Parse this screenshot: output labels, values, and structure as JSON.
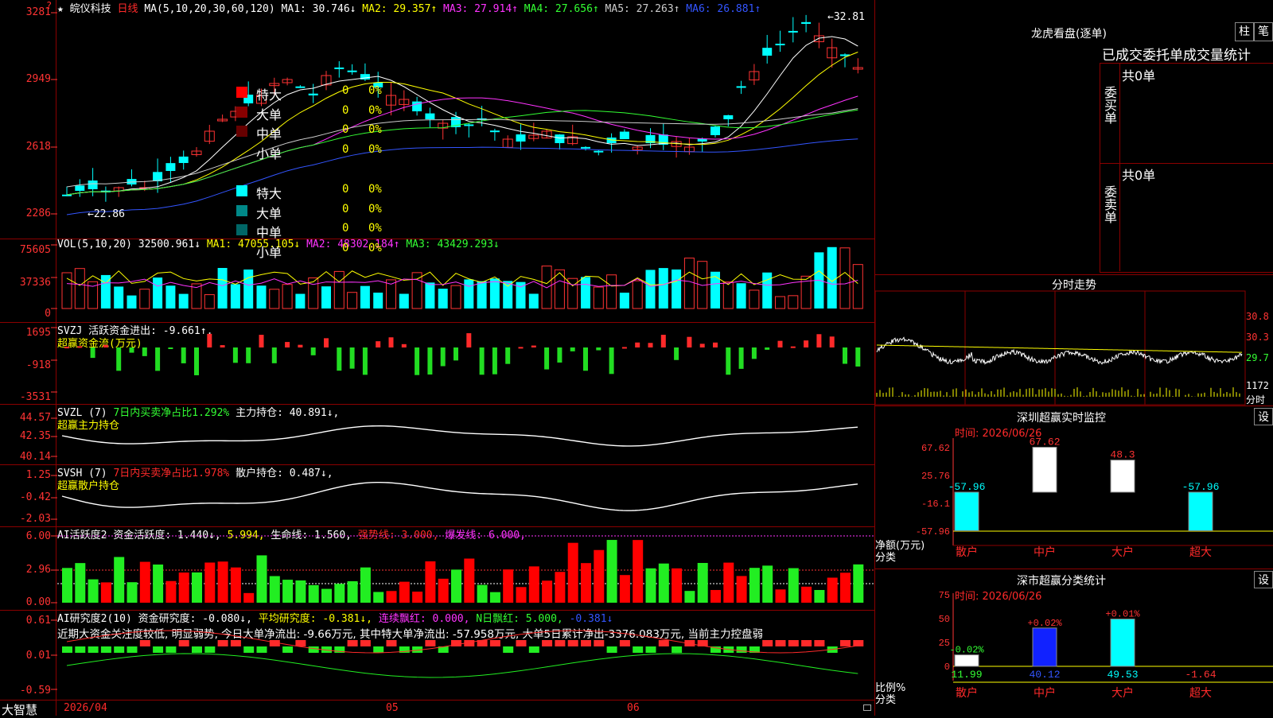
{
  "stock": {
    "name": "皖仪科技",
    "period": "日线",
    "star": "★",
    "q": "?"
  },
  "ma_line": {
    "label": "MA(5,10,20,30,60,120)",
    "items": [
      {
        "text": "MA1: 30.746↓",
        "color": "#ffffff"
      },
      {
        "text": "MA2: 29.357↑",
        "color": "#ffff00"
      },
      {
        "text": "MA3: 27.914↑",
        "color": "#ff33ff"
      },
      {
        "text": "MA4: 27.656↑",
        "color": "#33ff33"
      },
      {
        "text": "MA5: 27.263↑",
        "color": "#cccccc"
      },
      {
        "text": "MA6: 26.881↑",
        "color": "#3355ff"
      }
    ]
  },
  "price_axis": [
    "3281",
    "2949",
    "2618",
    "2286"
  ],
  "price_marks": {
    "high": "32.81",
    "low": "22.86"
  },
  "vol": {
    "label": "VOL(5,10,20)",
    "value": "32500.961↓",
    "ma1": "MA1: 47055.105↓",
    "ma2": "MA2: 48302.184↑",
    "ma3": "MA3: 43429.293↓",
    "axis": [
      "75605",
      "37336",
      "0"
    ]
  },
  "svzj": {
    "label": "SVZJ",
    "text": "活跃资金进出: -9.661↑,",
    "sub": "超赢资金流(万元)",
    "axis": [
      "1695",
      "-918",
      "-3531"
    ]
  },
  "svzl": {
    "label": "SVZL (7)",
    "text1": "7日内买卖净占比1.292%",
    "text2": "主力持仓: 40.891↓,",
    "sub": "超赢主力持仓",
    "axis": [
      "44.57",
      "42.35",
      "40.14"
    ]
  },
  "svsh": {
    "label": "SVSH (7)",
    "text1": "7日内买卖净占比1.978%",
    "text2": "散户持仓: 0.487↓,",
    "sub": "超赢散户持仓",
    "axis": [
      "1.25",
      "-0.42",
      "-2.03"
    ]
  },
  "ai1": {
    "label": "AI活跃度2",
    "t1": "资金活跃度: 1.440↓,",
    "t2": "5.994,",
    "t3": "生命线: 1.560,",
    "t4": "强势线: 3.000,",
    "t5": "爆发线: 6.000,",
    "axis": [
      "6.00",
      "2.96",
      "0.00"
    ]
  },
  "ai2": {
    "label": "AI研究度2(10)",
    "t1": "资金研究度: -0.080↓,",
    "t2": "平均研究度: -0.381↓,",
    "t3": "连续飘红: 0.000,",
    "t4": "N日飘红: 5.000,",
    "t5": "-0.381↓",
    "comment": "近期大资金关注度较低, 明显弱势, 今日大单净流出: -9.66万元, 其中特大单净流出: -57.958万元, 大单5日累计净出-3376.083万元, 当前主力控盘弱",
    "axis": [
      "0.61",
      "0.01",
      "-0.59"
    ]
  },
  "date_axis": {
    "brand": "大智慧",
    "d1": "2026/04",
    "d2": "05",
    "d3": "06"
  },
  "right": {
    "title": "龙虎看盘(逐单)",
    "btn1": "柱",
    "btn2": "笔",
    "tabs": "已成交委托单成交量统计",
    "buy_label": "委买单",
    "sell_label": "委卖单",
    "buy_total": "共0单",
    "sell_total": "共0单",
    "buy_rows": [
      {
        "name": "特大",
        "n": "0",
        "p": "0%",
        "c": "#ff0000"
      },
      {
        "name": "大单",
        "n": "0",
        "p": "0%",
        "c": "#880000"
      },
      {
        "name": "中单",
        "n": "0",
        "p": "0%",
        "c": "#660000"
      },
      {
        "name": "小单",
        "n": "0",
        "p": "0%",
        "c": ""
      }
    ],
    "sell_rows": [
      {
        "name": "特大",
        "n": "0",
        "p": "0%",
        "c": "#00ffff"
      },
      {
        "name": "大单",
        "n": "0",
        "p": "0%",
        "c": "#008888"
      },
      {
        "name": "中单",
        "n": "0",
        "p": "0%",
        "c": "#006666"
      },
      {
        "name": "小单",
        "n": "0",
        "p": "0%",
        "c": ""
      }
    ],
    "intraday": {
      "title": "分时走势",
      "axis": [
        "30.8",
        "30.3",
        "29.7",
        "1172"
      ],
      "unit": "分时"
    },
    "monitor": {
      "title": "深圳超赢实时监控",
      "btn": "设",
      "time": "时间: 2026/06/26",
      "axis": [
        "67.62",
        "25.76",
        "-16.1",
        "-57.96"
      ],
      "ylabel1": "净额(万元)",
      "ylabel2": "分类",
      "categories": [
        "散户",
        "中户",
        "大户",
        "超大"
      ],
      "values": [
        -57.96,
        67.62,
        48.3,
        -57.96
      ],
      "labels": [
        "-57.96",
        "67.62",
        "48.3",
        "-57.96"
      ]
    },
    "classify": {
      "title": "深市超赢分类统计",
      "btn": "设",
      "time": "时间: 2026/06/26",
      "axis": [
        "75",
        "50",
        "25",
        "0"
      ],
      "ylabel1": "比例%",
      "ylabel2": "分类",
      "categories": [
        "散户",
        "中户",
        "大户",
        "超大"
      ],
      "values": [
        11.99,
        40.12,
        49.53,
        -1.64
      ],
      "labels": [
        "11.99",
        "40.12",
        "49.53",
        "-1.64"
      ],
      "changes": [
        "-0.02%",
        "+0.02%",
        "+0.01%",
        ""
      ]
    }
  }
}
